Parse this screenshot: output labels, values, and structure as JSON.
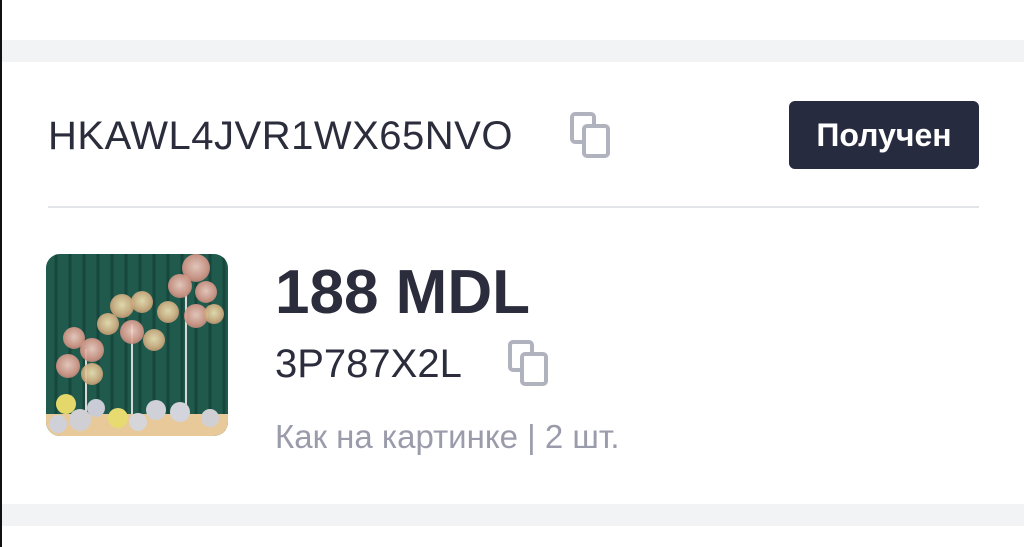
{
  "order": {
    "id": "HKAWL4JVR1WX65NVO",
    "status": "Получен"
  },
  "item": {
    "price": "188 MDL",
    "sku": "3P787X2L",
    "variant": "Как на картинке | 2 шт."
  },
  "icons": {
    "copy_order": "copy-icon",
    "copy_sku": "copy-icon",
    "thumbnail": "balloon-stand-photo"
  },
  "colors": {
    "text": "#2b2d3c",
    "muted": "#9a9cab",
    "badge_bg": "#272b40",
    "band": "#f2f3f5",
    "icon": "#b0b2bd"
  }
}
